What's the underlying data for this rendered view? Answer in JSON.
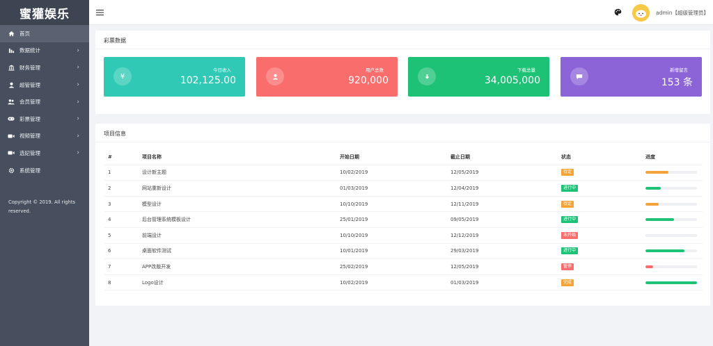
{
  "brand": "蜜獾娱乐",
  "sidebar": {
    "items": [
      {
        "label": "首页",
        "icon": "home-icon",
        "arrow": ""
      },
      {
        "label": "数据统计",
        "icon": "bar-chart-icon",
        "arrow": "›"
      },
      {
        "label": "财务管理",
        "icon": "bank-icon",
        "arrow": "›"
      },
      {
        "label": "超管管理",
        "icon": "user-icon",
        "arrow": "›"
      },
      {
        "label": "会员管理",
        "icon": "users-icon",
        "arrow": "›"
      },
      {
        "label": "彩票管理",
        "icon": "gamepad-icon",
        "arrow": "›"
      },
      {
        "label": "视频管理",
        "icon": "video-icon",
        "arrow": "›"
      },
      {
        "label": "选妃管理",
        "icon": "camera-icon",
        "arrow": "›"
      },
      {
        "label": "系统管理",
        "icon": "gear-icon",
        "arrow": ""
      }
    ],
    "copyright": "Copyright © 2019. All rights reserved."
  },
  "header": {
    "user": "admin【超级管理员】"
  },
  "lottery": {
    "title": "彩票数据",
    "cards": [
      {
        "label": "今日收入",
        "value": "102,125.00",
        "glyph": "¥",
        "color": "#30c9b5"
      },
      {
        "label": "用户总数",
        "value": "920,000",
        "glyph": "person",
        "color": "#fa6d6d"
      },
      {
        "label": "下载总量",
        "value": "34,005,000",
        "glyph": "download",
        "color": "#1ec277"
      },
      {
        "label": "新增留言",
        "value": "153 条",
        "glyph": "chat",
        "color": "#8c64d8"
      }
    ]
  },
  "projects": {
    "title": "项目信息",
    "columns": [
      "#",
      "项目名称",
      "开始日期",
      "截止日期",
      "状态",
      "进度"
    ],
    "rows": [
      {
        "no": "1",
        "name": "设计新主题",
        "start": "10/02/2019",
        "end": "12/05/2019",
        "status": "待定",
        "status_color": "#f4a338",
        "progress": 45,
        "bar_color": "#f4a338"
      },
      {
        "no": "2",
        "name": "网站重新设计",
        "start": "01/03/2019",
        "end": "12/04/2019",
        "status": "进行中",
        "status_color": "#1ec277",
        "progress": 30,
        "bar_color": "#1ec277"
      },
      {
        "no": "3",
        "name": "模型设计",
        "start": "10/10/2019",
        "end": "12/11/2019",
        "status": "待定",
        "status_color": "#f4a338",
        "progress": 25,
        "bar_color": "#f4a338"
      },
      {
        "no": "4",
        "name": "后台管理系统模板设计",
        "start": "25/01/2019",
        "end": "09/05/2019",
        "status": "进行中",
        "status_color": "#1ec277",
        "progress": 55,
        "bar_color": "#1ec277"
      },
      {
        "no": "5",
        "name": "前端设计",
        "start": "10/10/2019",
        "end": "12/12/2019",
        "status": "未开始",
        "status_color": "#fa6d6d",
        "progress": 0,
        "bar_color": "#fa6d6d"
      },
      {
        "no": "6",
        "name": "桌面软件测试",
        "start": "10/01/2019",
        "end": "29/03/2019",
        "status": "进行中",
        "status_color": "#1ec277",
        "progress": 75,
        "bar_color": "#1ec277"
      },
      {
        "no": "7",
        "name": "APP改版开发",
        "start": "25/02/2019",
        "end": "12/05/2019",
        "status": "暂停",
        "status_color": "#fa6d6d",
        "progress": 15,
        "bar_color": "#fa6d6d"
      },
      {
        "no": "8",
        "name": "Logo设计",
        "start": "10/02/2019",
        "end": "01/03/2019",
        "status": "完成",
        "status_color": "#f4a338",
        "progress": 100,
        "bar_color": "#1ec277"
      }
    ]
  }
}
